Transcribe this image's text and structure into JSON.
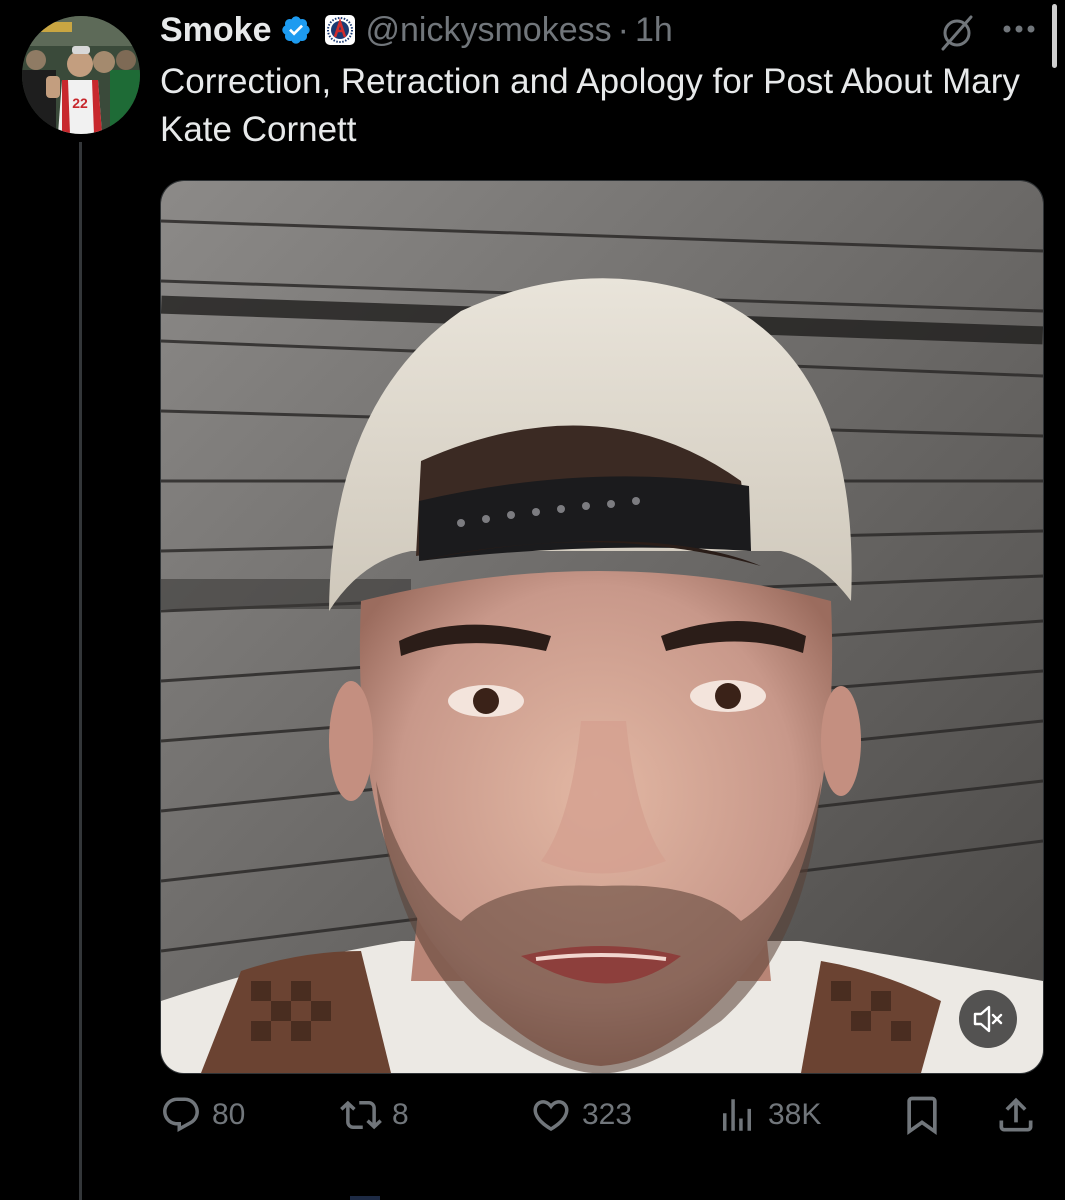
{
  "tweet": {
    "display_name": "Smoke",
    "handle": "@nickysmokess",
    "separator": "·",
    "time": "1h",
    "text": "Correction, Retraction and Apology for Post About Mary Kate Cornett",
    "avatar_jersey_number": "22"
  },
  "actions": {
    "replies": "80",
    "reposts": "8",
    "likes": "323",
    "views": "38K"
  },
  "icons": {
    "verified": "verified-badge-icon",
    "affiliate": "barstool-affiliate-badge-icon",
    "grok": "grok-icon",
    "more": "more-options-icon",
    "mute": "speaker-muted-icon",
    "reply": "reply-icon",
    "repost": "repost-icon",
    "like": "heart-icon",
    "views": "analytics-icon",
    "bookmark": "bookmark-icon",
    "share": "share-icon"
  },
  "colors": {
    "background": "#000000",
    "text_primary": "#e7e9ea",
    "text_secondary": "#71767b",
    "verified_blue": "#1d9bf0",
    "thread_line": "#333639"
  }
}
